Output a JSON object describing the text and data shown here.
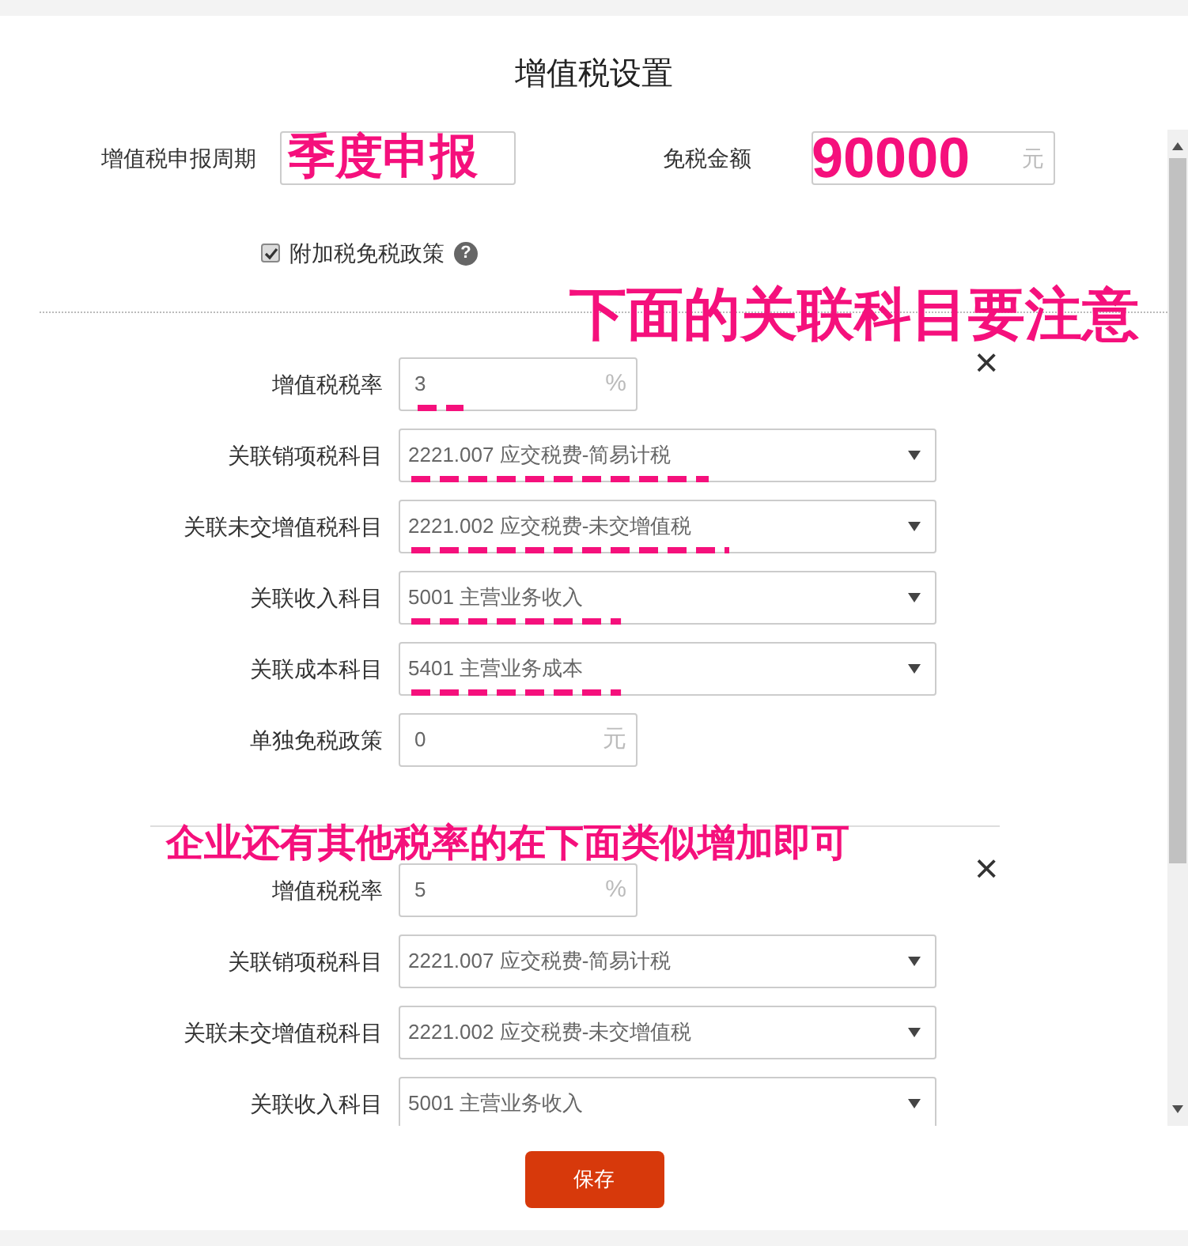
{
  "dialog": {
    "title": "增值税设置"
  },
  "period": {
    "label": "增值税申报周期",
    "value": "季度申报"
  },
  "exemption": {
    "label": "免税金额",
    "value": "90000",
    "unit": "元"
  },
  "surtax": {
    "label": "附加税免税政策",
    "checked": true,
    "help": "?"
  },
  "notes": [
    "下面的关联科目要注意",
    "企业还有其他税率的在下面类似增加即可"
  ],
  "groups": [
    {
      "close": "×",
      "rows": [
        {
          "kind": "input",
          "label": "增值税税率",
          "value": "3",
          "unit": "%",
          "annotated": true
        },
        {
          "kind": "select",
          "label": "关联销项税科目",
          "value": "2221.007 应交税费-简易计税",
          "annotated": true
        },
        {
          "kind": "select",
          "label": "关联未交增值税科目",
          "value": "2221.002 应交税费-未交增值税",
          "annotated": true
        },
        {
          "kind": "select",
          "label": "关联收入科目",
          "value": "5001 主营业务收入",
          "annotated": true
        },
        {
          "kind": "select",
          "label": "关联成本科目",
          "value": "5401 主营业务成本",
          "annotated": true
        },
        {
          "kind": "input",
          "label": "单独免税政策",
          "value": "0",
          "unit": "元",
          "annotated": false
        }
      ]
    },
    {
      "close": "×",
      "rows": [
        {
          "kind": "input",
          "label": "增值税税率",
          "value": "5",
          "unit": "%",
          "annotated": false
        },
        {
          "kind": "select",
          "label": "关联销项税科目",
          "value": "2221.007 应交税费-简易计税",
          "annotated": false
        },
        {
          "kind": "select",
          "label": "关联未交增值税科目",
          "value": "2221.002 应交税费-未交增值税",
          "annotated": false
        },
        {
          "kind": "select",
          "label": "关联收入科目",
          "value": "5001 主营业务收入",
          "annotated": false
        }
      ]
    }
  ],
  "save_button": "保存"
}
